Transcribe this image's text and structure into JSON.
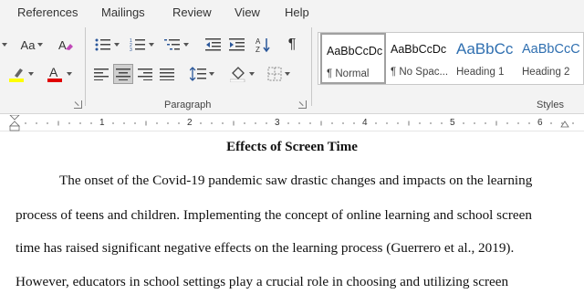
{
  "menu_tabs": [
    "References",
    "Mailings",
    "Review",
    "View",
    "Help"
  ],
  "ribbon": {
    "font_group": {
      "change_case_label": "Aa",
      "highlight_color": "#ffff00",
      "font_color": "#e00000"
    },
    "paragraph_group": {
      "label": "Paragraph",
      "pilcrow": "¶",
      "sort_label": "A↓Z"
    },
    "styles_group": {
      "label": "Styles",
      "items": [
        {
          "sample": "AaBbCcDc",
          "name": "¶ Normal"
        },
        {
          "sample": "AaBbCcDc",
          "name": "¶ No Spac..."
        },
        {
          "sample": "AaBbCc",
          "name": "Heading 1"
        },
        {
          "sample": "AaBbCcC",
          "name": "Heading 2"
        }
      ]
    }
  },
  "ruler": {
    "labels": [
      "1",
      "2",
      "3",
      "4",
      "5",
      "6"
    ]
  },
  "document": {
    "title": "Effects of Screen Time",
    "lines": [
      "The onset of the Covid-19 pandemic saw drastic changes and impacts on the learning",
      "process of teens and children. Implementing the concept of online learning and school screen",
      "time has raised significant negative effects on the learning process (Guerrero et al., 2019).",
      "However, educators in school settings play a crucial role in choosing and utilizing screen"
    ]
  }
}
